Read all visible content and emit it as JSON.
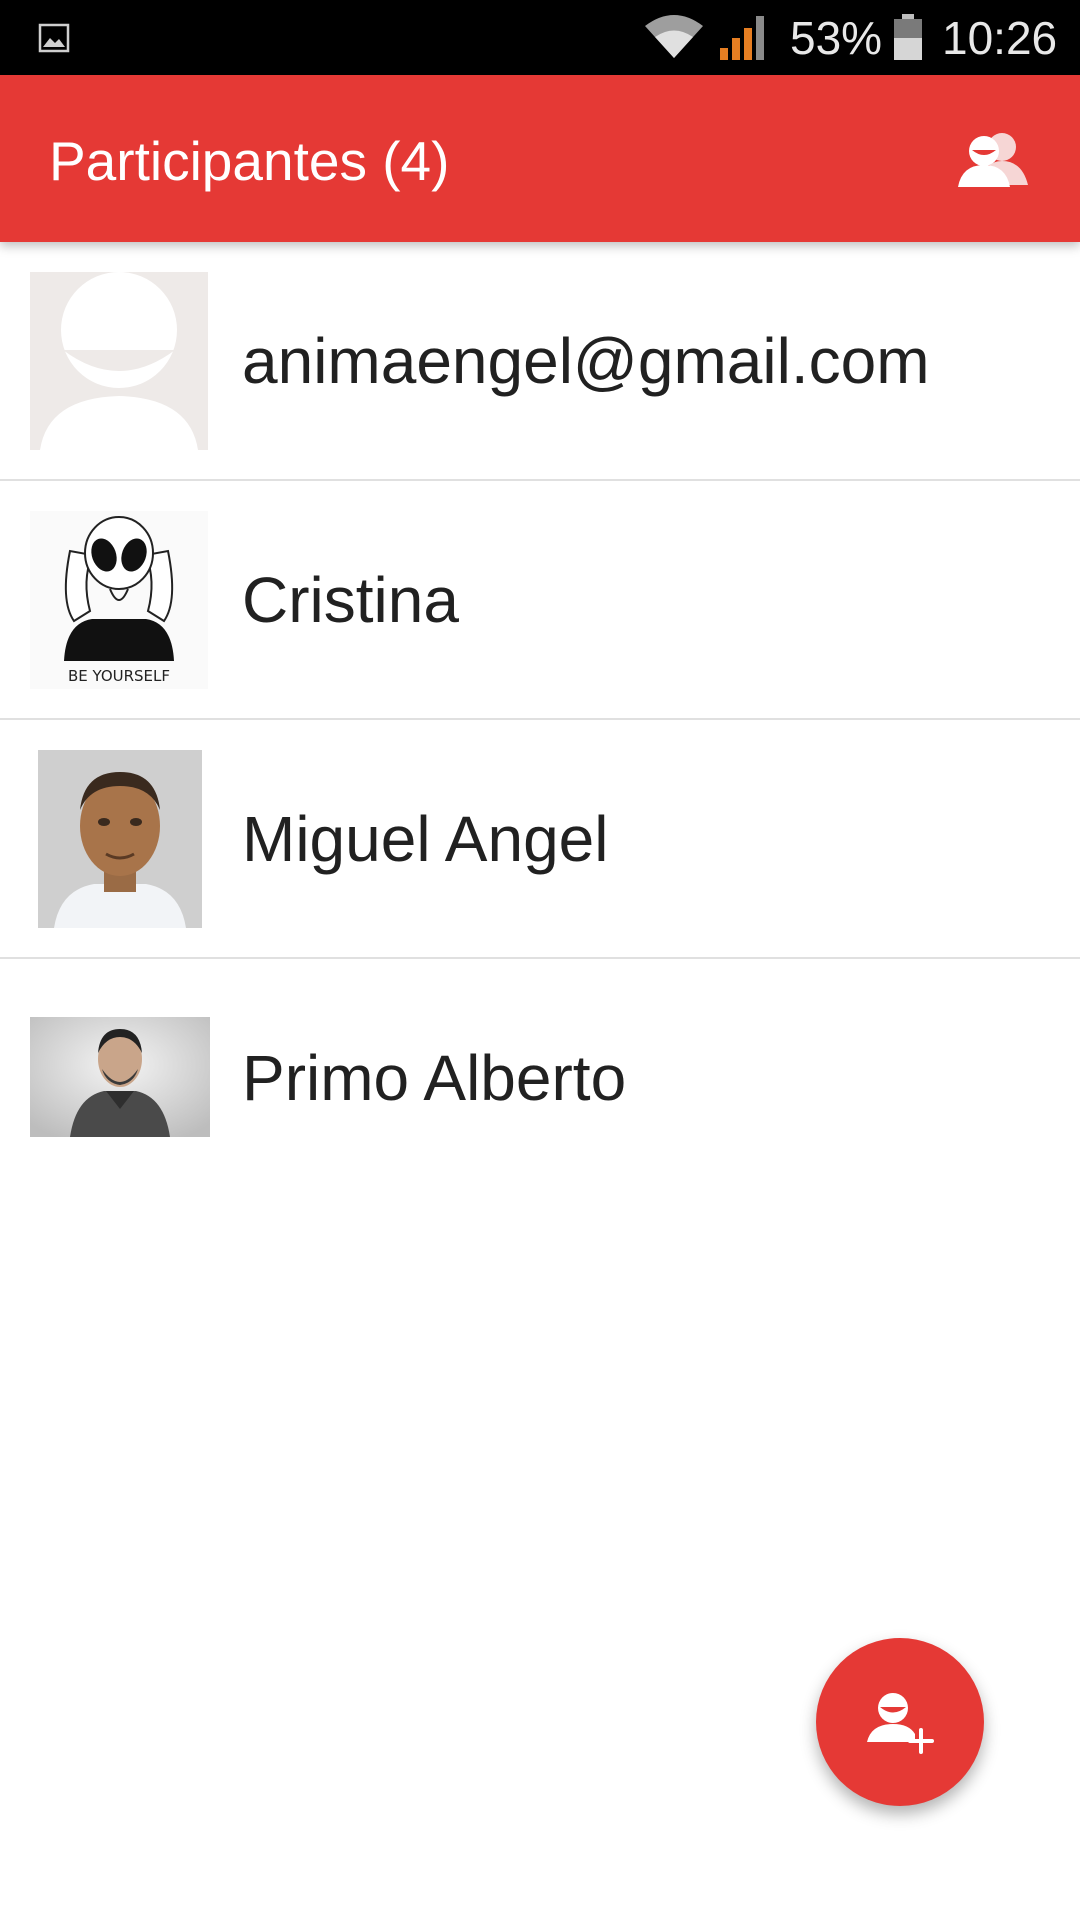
{
  "status_bar": {
    "notification_icon": "gallery-icon",
    "wifi_icon": "wifi-icon",
    "signal_icon": "signal-icon",
    "battery_percent": "53%",
    "battery_icon": "battery-icon",
    "time": "10:26"
  },
  "app_bar": {
    "title": "Participantes (4)",
    "action_icon": "group-icon",
    "color": "#e53935"
  },
  "participants": [
    {
      "name": "animaengel@gmail.com",
      "avatar": "default-avatar"
    },
    {
      "name": "Cristina",
      "avatar": "alien-be-yourself-avatar",
      "avatar_caption": "BE YOURSELF"
    },
    {
      "name": "Miguel Angel",
      "avatar": "photo-avatar"
    },
    {
      "name": "Primo Alberto",
      "avatar": "photo-avatar"
    }
  ],
  "fab": {
    "icon": "add-person-icon",
    "color": "#e53935"
  }
}
